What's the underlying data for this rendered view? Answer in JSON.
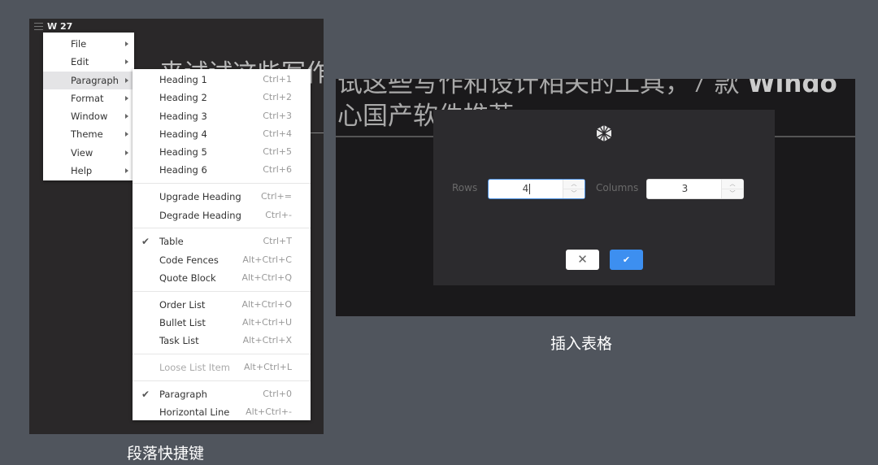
{
  "left_window": {
    "title": "W 27",
    "background_heading": "来试试这些写作和设计",
    "main_menu": [
      {
        "label": "File",
        "has_submenu": true
      },
      {
        "label": "Edit",
        "has_submenu": true
      },
      {
        "label": "Paragraph",
        "has_submenu": true,
        "active": true
      },
      {
        "label": "Format",
        "has_submenu": true
      },
      {
        "label": "Window",
        "has_submenu": true
      },
      {
        "label": "Theme",
        "has_submenu": true
      },
      {
        "label": "View",
        "has_submenu": true
      },
      {
        "label": "Help",
        "has_submenu": true
      }
    ],
    "paragraph_submenu": [
      {
        "label": "Heading 1",
        "shortcut": "Ctrl+1"
      },
      {
        "label": "Heading 2",
        "shortcut": "Ctrl+2"
      },
      {
        "label": "Heading 3",
        "shortcut": "Ctrl+3"
      },
      {
        "label": "Heading 4",
        "shortcut": "Ctrl+4"
      },
      {
        "label": "Heading 5",
        "shortcut": "Ctrl+5"
      },
      {
        "label": "Heading 6",
        "shortcut": "Ctrl+6"
      },
      {
        "label": "Upgrade Heading",
        "shortcut": "Ctrl+="
      },
      {
        "label": "Degrade Heading",
        "shortcut": "Ctrl+-"
      },
      {
        "label": "Table",
        "shortcut": "Ctrl+T",
        "checked": true
      },
      {
        "label": "Code Fences",
        "shortcut": "Alt+Ctrl+C"
      },
      {
        "label": "Quote Block",
        "shortcut": "Alt+Ctrl+Q"
      },
      {
        "label": "Order List",
        "shortcut": "Alt+Ctrl+O"
      },
      {
        "label": "Bullet List",
        "shortcut": "Alt+Ctrl+U"
      },
      {
        "label": "Task List",
        "shortcut": "Alt+Ctrl+X"
      },
      {
        "label": "Loose List Item",
        "shortcut": "Alt+Ctrl+L",
        "disabled": true
      },
      {
        "label": "Paragraph",
        "shortcut": "Ctrl+0",
        "checked": true
      },
      {
        "label": "Horizontal Line",
        "shortcut": "Alt+Ctrl+-"
      }
    ],
    "check_glyph": "✔"
  },
  "right_window": {
    "background_heading_line1_a": "试这些写作和设计相关的工具，7 款 ",
    "background_heading_line1_b": "Windo",
    "background_heading_line2": "心国产软件推荐",
    "dialog": {
      "icon": "typora-logo-icon",
      "rows_label": "Rows",
      "rows_value": "4",
      "columns_label": "Columns",
      "columns_value": "3",
      "cancel_glyph": "✕",
      "ok_glyph": "✔",
      "accent_color": "#3d8ff0"
    }
  },
  "captions": {
    "left": "段落快捷键",
    "right": "插入表格"
  }
}
